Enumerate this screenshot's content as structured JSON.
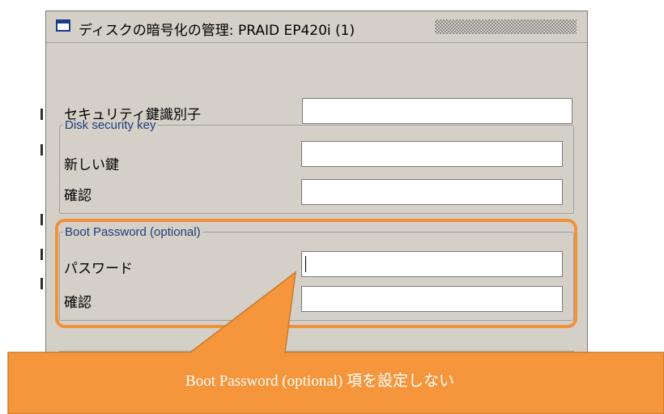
{
  "dialog": {
    "title": "ディスクの暗号化の管理: PRAID EP420i (1)",
    "security_key_id_label": "セキュリティ鍵識別子",
    "security_key_id_value": "",
    "disk_key_group": {
      "legend": "Disk security key",
      "new_key_label": "新しい鍵",
      "new_key_value": "",
      "confirm_label": "確認",
      "confirm_value": ""
    },
    "boot_password_group": {
      "legend": "Boot Password (optional)",
      "password_label": "パスワード",
      "password_value": "",
      "confirm_label": "確認",
      "confirm_value": ""
    }
  },
  "callout": {
    "text": "Boot Password (optional) 項を設定しない",
    "color": "#f5963c",
    "border_color": "#c87a2e"
  },
  "highlight_color": "#f0923a",
  "icons": [
    "window-icon"
  ]
}
